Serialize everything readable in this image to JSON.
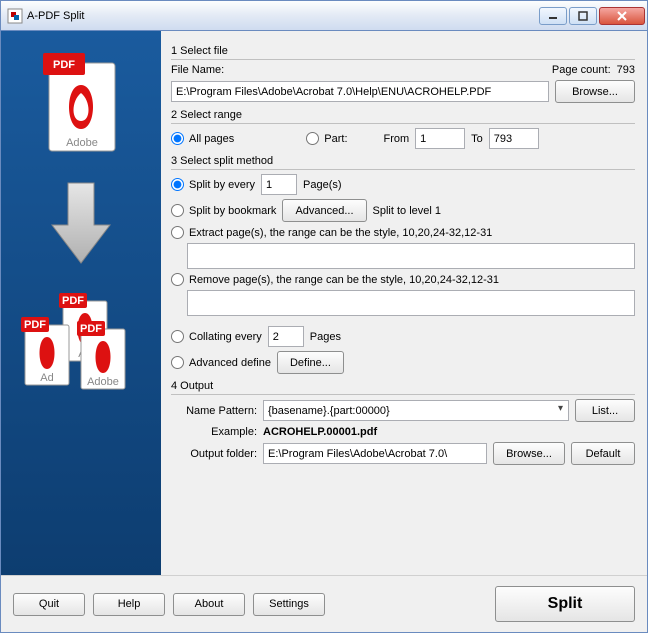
{
  "title": "A-PDF Split",
  "section1": {
    "head": "1 Select file",
    "fileNameLabel": "File Name:",
    "fileName": "E:\\Program Files\\Adobe\\Acrobat 7.0\\Help\\ENU\\ACROHELP.PDF",
    "pageCountLabel": "Page count:",
    "pageCount": "793",
    "browse": "Browse..."
  },
  "section2": {
    "head": "2 Select range",
    "allPages": "All pages",
    "part": "Part:",
    "fromLabel": "From",
    "from": "1",
    "toLabel": "To",
    "to": "793"
  },
  "section3": {
    "head": "3 Select split method",
    "splitEvery": "Split by every",
    "splitEveryN": "1",
    "splitEveryUnit": "Page(s)",
    "byBookmark": "Split by bookmark",
    "advanced": "Advanced...",
    "bookmarkLevel": "Split to level 1",
    "extract": "Extract page(s), the range can be the style, 10,20,24-32,12-31",
    "extractVal": "",
    "remove": "Remove page(s), the range can be the style, 10,20,24-32,12-31",
    "removeVal": "",
    "collating": "Collating every",
    "collatingN": "2",
    "collatingUnit": "Pages",
    "advDefine": "Advanced define",
    "define": "Define..."
  },
  "section4": {
    "head": "4 Output",
    "patternLabel": "Name Pattern:",
    "pattern": "{basename}.{part:00000}",
    "list": "List...",
    "exampleLabel": "Example:",
    "example": "ACROHELP.00001.pdf",
    "folderLabel": "Output folder:",
    "folder": "E:\\Program Files\\Adobe\\Acrobat 7.0\\",
    "browse": "Browse...",
    "default": "Default"
  },
  "footer": {
    "quit": "Quit",
    "help": "Help",
    "about": "About",
    "settings": "Settings",
    "split": "Split"
  }
}
